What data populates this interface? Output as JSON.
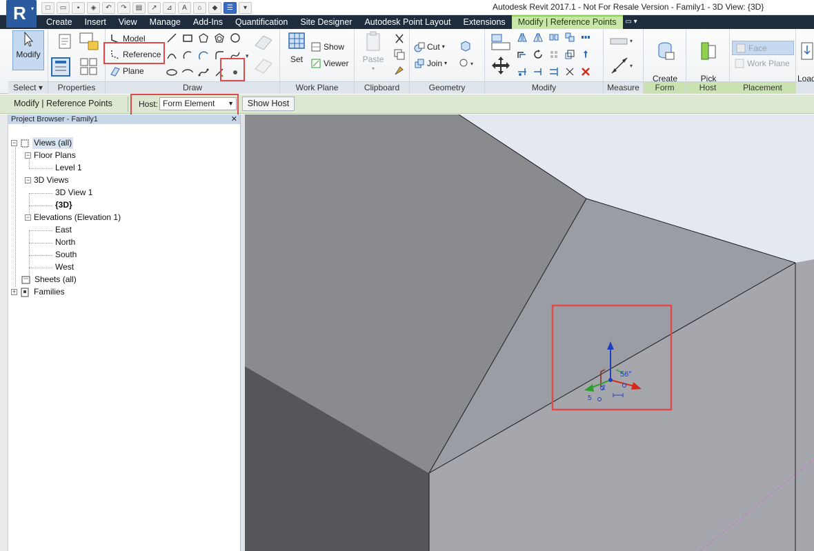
{
  "window": {
    "title": "Autodesk Revit 2017.1 - Not For Resale Version -     Family1 - 3D View: {3D}",
    "logo_letter": "R"
  },
  "tabs": [
    {
      "label": "Create"
    },
    {
      "label": "Insert"
    },
    {
      "label": "View"
    },
    {
      "label": "Manage"
    },
    {
      "label": "Add-Ins"
    },
    {
      "label": "Quantification"
    },
    {
      "label": "Site Designer"
    },
    {
      "label": "Autodesk Point Layout"
    },
    {
      "label": "Extensions"
    },
    {
      "label": "Modify | Reference Points",
      "active": true
    }
  ],
  "ribbon": {
    "select": {
      "modify_label": "Modify",
      "panel_label": "Select ▾"
    },
    "properties": {
      "panel_label": "Properties"
    },
    "draw": {
      "model_label": "Model",
      "reference_label": "Reference",
      "plane_label": "Plane",
      "panel_label": "Draw"
    },
    "work_plane": {
      "set_label": "Set",
      "show_label": "Show",
      "viewer_label": "Viewer",
      "panel_label": "Work Plane"
    },
    "clipboard": {
      "paste_label": "Paste",
      "panel_label": "Clipboard"
    },
    "geometry": {
      "cut_label": "Cut",
      "join_label": "Join",
      "panel_label": "Geometry"
    },
    "modify": {
      "panel_label": "Modify"
    },
    "measure": {
      "panel_label": "Measure"
    },
    "form": {
      "create_form_label": "Create\nForm",
      "panel_label": "Form"
    },
    "host": {
      "pick_new_host_label": "Pick\nNew Host",
      "panel_label": "Host"
    },
    "placement": {
      "face_label": "Face",
      "work_plane_label": "Work Plane",
      "panel_label": "Placement"
    },
    "load": {
      "label": "Load\nPro"
    }
  },
  "options_bar": {
    "context_label": "Modify | Reference Points",
    "host_label": "Host:",
    "host_value": "Form Element",
    "show_host_label": "Show Host"
  },
  "project_browser": {
    "title": "Project Browser - Family1",
    "close": "✕",
    "nodes": [
      {
        "label": "Views (all)"
      },
      {
        "label": "Floor Plans"
      },
      {
        "label": "Level 1"
      },
      {
        "label": "3D Views"
      },
      {
        "label": "3D View 1"
      },
      {
        "label": "{3D}"
      },
      {
        "label": "Elevations (Elevation 1)"
      },
      {
        "label": "East"
      },
      {
        "label": "North"
      },
      {
        "label": "South"
      },
      {
        "label": "West"
      },
      {
        "label": "Sheets (all)"
      },
      {
        "label": "Families"
      }
    ]
  },
  "viewport": {
    "gizmo_angle_label": "56°",
    "gizmo_small_label_1": "5",
    "gizmo_small_label_2": "2"
  },
  "colors": {
    "annotation_red": "#e04a4a",
    "tab_bar": "#1e2c3e",
    "contextual_tab": "#c8e6a8",
    "options_bar": "#dce8d2",
    "gizmo_z": "#1e3fbf",
    "gizmo_x": "#d42a1a",
    "gizmo_y": "#2aa02a"
  }
}
